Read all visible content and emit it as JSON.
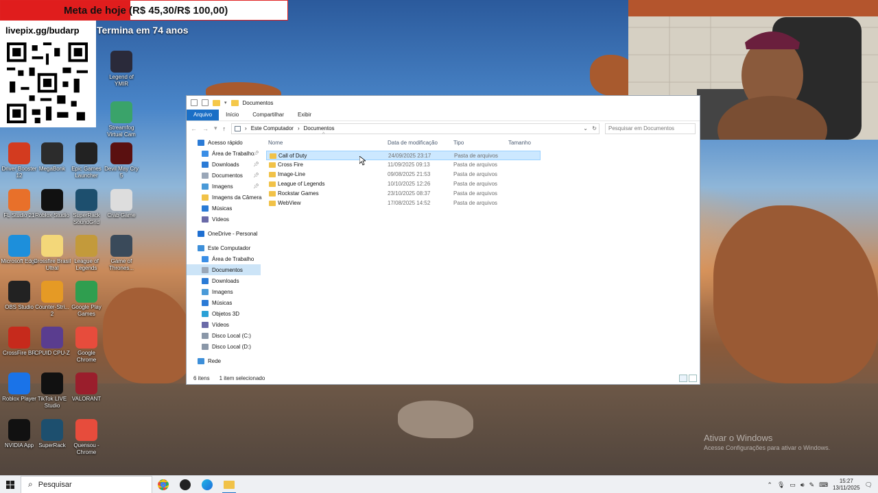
{
  "overlay": {
    "goal_label": "Meta de hoje (R$ 45,30/R$ 100,00)",
    "goal_fraction": 0.453,
    "timer": "Termina em 74 anos",
    "livepix_url": "livepix.gg/budarp"
  },
  "desktop": {
    "icons": [
      {
        "label": "Legend of YMIR",
        "name": "legend-of-ymir-icon",
        "color": "#2a2a3a"
      },
      {
        "label": "Streamfog Virtual Cam",
        "name": "streamfog-icon",
        "color": "#3aa36a"
      },
      {
        "label": "Driver Booster 12",
        "name": "driver-booster-icon",
        "color": "#d33b1f"
      },
      {
        "label": "MegaBonk",
        "name": "megabonk-icon",
        "color": "#2c2c2c"
      },
      {
        "label": "Epic Games Launcher",
        "name": "epic-games-icon",
        "color": "#222"
      },
      {
        "label": "Devil May Cry 5",
        "name": "devil-may-cry-icon",
        "color": "#5a1010"
      },
      {
        "label": "FL Studio 21",
        "name": "fl-studio-icon",
        "color": "#e8702a"
      },
      {
        "label": "Roblox Studio",
        "name": "roblox-studio-icon",
        "color": "#111"
      },
      {
        "label": "SuperRack SoundGrid",
        "name": "superrack-soundgrid-icon",
        "color": "#1d4f6e"
      },
      {
        "label": "Crab Game",
        "name": "crab-game-icon",
        "color": "#ddd"
      },
      {
        "label": "Microsoft Edge",
        "name": "edge-icon",
        "color": "#1d8fdb"
      },
      {
        "label": "Crossfire Brasil Ultral",
        "name": "crossfire-folder-icon",
        "color": "#f3d779"
      },
      {
        "label": "League of Legends",
        "name": "league-of-legends-icon",
        "color": "#c39a3b"
      },
      {
        "label": "Game of Thrones...",
        "name": "game-of-thrones-icon",
        "color": "#3a4a5a"
      },
      {
        "label": "OBS Studio",
        "name": "obs-icon",
        "color": "#222"
      },
      {
        "label": "Counter-Stri... 2",
        "name": "counter-strike-icon",
        "color": "#e59a25"
      },
      {
        "label": "Google Play Games",
        "name": "google-play-games-icon",
        "color": "#2f9e4f"
      },
      {
        "label": "CrossFire BR",
        "name": "crossfire-br-icon",
        "color": "#c62a1c"
      },
      {
        "label": "CPUID CPU-Z",
        "name": "cpu-z-icon",
        "color": "#5a3d8f"
      },
      {
        "label": "Google Chrome",
        "name": "chrome-icon",
        "color": "#e74c3c"
      },
      {
        "label": "Roblox Player",
        "name": "roblox-player-icon",
        "color": "#1a73e8"
      },
      {
        "label": "TikTok LIVE Studio",
        "name": "tiktok-live-icon",
        "color": "#111"
      },
      {
        "label": "VALORANT",
        "name": "valorant-icon",
        "color": "#9a1e2c"
      },
      {
        "label": "NVIDIA App",
        "name": "nvidia-icon",
        "color": "#111"
      },
      {
        "label": "SuperRack",
        "name": "superrack-icon",
        "color": "#1d4f6e"
      },
      {
        "label": "Quensou - Chrome",
        "name": "quensou-chrome-icon",
        "color": "#e74c3c"
      }
    ]
  },
  "explorer": {
    "title": "Documentos",
    "tabs": [
      "Arquivo",
      "Início",
      "Compartilhar",
      "Exibir"
    ],
    "breadcrumb": [
      "Este Computador",
      "Documentos"
    ],
    "search_placeholder": "Pesquisar em Documentos",
    "columns": [
      "Nome",
      "Data de modificação",
      "Tipo",
      "Tamanho"
    ],
    "nav": [
      {
        "label": "Acesso rápido",
        "top": true,
        "color": "#2b7bd6"
      },
      {
        "label": "Área de Trabalho",
        "pin": true,
        "color": "#3a8ee6"
      },
      {
        "label": "Downloads",
        "pin": true,
        "color": "#2b7bd6"
      },
      {
        "label": "Documentos",
        "pin": true,
        "color": "#9aa7b8"
      },
      {
        "label": "Imagens",
        "pin": true,
        "color": "#4a9ad8"
      },
      {
        "label": "Imagens da Câmera",
        "color": "#f1c248"
      },
      {
        "label": "Músicas",
        "color": "#2b7bd6"
      },
      {
        "label": "Vídeos",
        "color": "#6a6aa8"
      },
      {
        "label": "",
        "spacer": true
      },
      {
        "label": "OneDrive - Personal",
        "top": true,
        "color": "#1f6fd1"
      },
      {
        "label": "",
        "spacer": true
      },
      {
        "label": "Este Computador",
        "top": true,
        "color": "#3d8fd9"
      },
      {
        "label": "Área de Trabalho",
        "color": "#3a8ee6"
      },
      {
        "label": "Documentos",
        "color": "#9aa7b8",
        "selected": true
      },
      {
        "label": "Downloads",
        "color": "#2b7bd6"
      },
      {
        "label": "Imagens",
        "color": "#4a9ad8"
      },
      {
        "label": "Músicas",
        "color": "#2b7bd6"
      },
      {
        "label": "Objetos 3D",
        "color": "#2aa0d6"
      },
      {
        "label": "Vídeos",
        "color": "#6a6aa8"
      },
      {
        "label": "Disco Local (C:)",
        "color": "#8a97a8"
      },
      {
        "label": "Disco Local (D:)",
        "color": "#8a97a8"
      },
      {
        "label": "",
        "spacer": true
      },
      {
        "label": "Rede",
        "top": true,
        "color": "#3d8fd9"
      }
    ],
    "files": [
      {
        "name": "Call of Duty",
        "date": "24/09/2025 23:17",
        "type": "Pasta de arquivos",
        "selected": true
      },
      {
        "name": "Cross Fire",
        "date": "11/09/2025 09:13",
        "type": "Pasta de arquivos"
      },
      {
        "name": "Image-Line",
        "date": "09/08/2025 21:53",
        "type": "Pasta de arquivos"
      },
      {
        "name": "League of Legends",
        "date": "10/10/2025 12:26",
        "type": "Pasta de arquivos"
      },
      {
        "name": "Rockstar Games",
        "date": "23/10/2025 08:37",
        "type": "Pasta de arquivos"
      },
      {
        "name": "WebView",
        "date": "17/08/2025 14:52",
        "type": "Pasta de arquivos"
      }
    ],
    "status_count": "6 itens",
    "status_selected": "1 item selecionado"
  },
  "watermark": {
    "line1": "Ativar o Windows",
    "line2": "Acesse Configurações para ativar o Windows."
  },
  "taskbar": {
    "search_label": "Pesquisar",
    "time": "15:27",
    "date": "13/11/2025"
  }
}
